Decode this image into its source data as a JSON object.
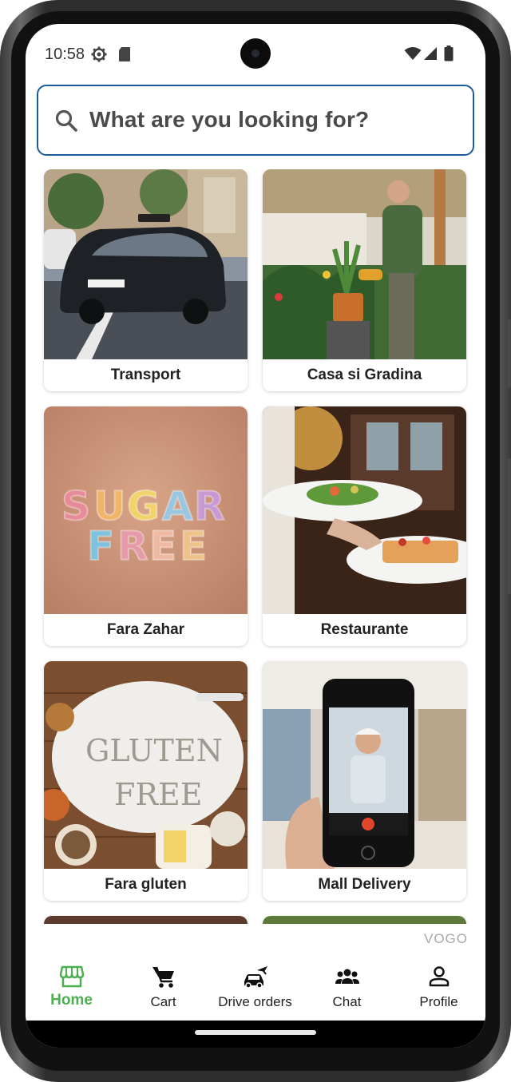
{
  "status_bar": {
    "time": "10:58",
    "icons": [
      "settings-icon",
      "sd-card-icon",
      "wifi-icon",
      "signal-icon",
      "battery-icon"
    ]
  },
  "search": {
    "placeholder": "What are you looking for?",
    "icon": "search-icon",
    "border_color": "#1a5c99"
  },
  "categories": [
    {
      "label": "Transport",
      "image": "taxi-car-street-image"
    },
    {
      "label": "Casa si Gradina",
      "image": "gardener-plants-image"
    },
    {
      "label": "Fara Zahar",
      "image": "sugar-free-letters-image"
    },
    {
      "label": "Restaurante",
      "image": "waiter-plates-image"
    },
    {
      "label": "Fara gluten",
      "image": "gluten-free-flour-image"
    },
    {
      "label": "Mall Delivery",
      "image": "mall-phone-courier-image"
    }
  ],
  "brand": "VOGO",
  "nav": {
    "accent_color": "#4caf50",
    "items": [
      {
        "label": "Home",
        "icon": "store-icon",
        "active": true
      },
      {
        "label": "Cart",
        "icon": "cart-icon",
        "active": false
      },
      {
        "label": "Drive orders",
        "icon": "drive-orders-icon",
        "active": false
      },
      {
        "label": "Chat",
        "icon": "group-chat-icon",
        "active": false
      },
      {
        "label": "Profile",
        "icon": "person-icon",
        "active": false
      }
    ]
  }
}
